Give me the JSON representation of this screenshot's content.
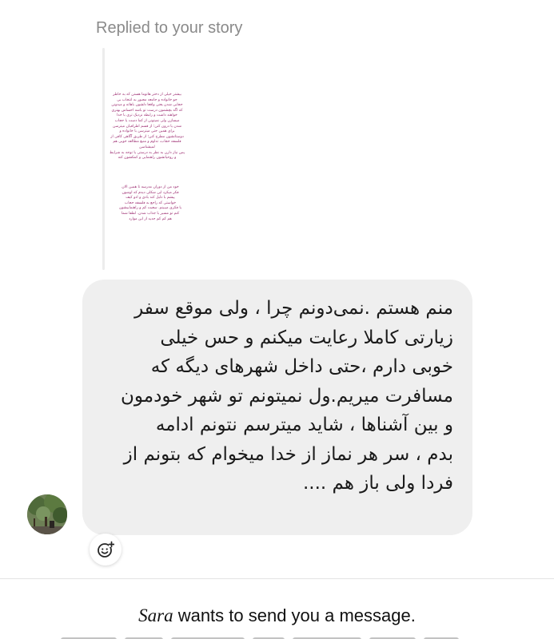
{
  "thread": {
    "reply_label": "Replied to your story"
  },
  "story": {
    "paragraph_1": "بیشتر خیلی از دختر هاتوما هستن که به خاطر\nجو خانواده و جامعه مجبور به انتخاب بی\nحجابی شدن یعنی واقعا دلشون باهاته و میدونن\nکه اگه بچشمون درست تو باشه احساس بهتری\nخواهند داشت و رابطه نزدیک تری با خدا\nمیسازن ولی نمیتونن از کما دست یا حجاب\nشدن یا درون کنن؛ از قسم اطرافیان میترسن\nبرای همین حتی میترسن با خانواده و\nدوستانشون مطرح کنن؛ از طریق آگاهی کافی از\nفلسفه حجاب، تداوم و منبع مطالعه خوبی هم\nلمیشناسن\nپس نیاز دارن به نظر به درستی یا توجه به شرایط\nو روحیاتشون راهنمایی و کمکشون کنه",
    "paragraph_2": "خود من از دوران مدرسه تا همین الان\nفکر میکرد این شکلی دیدم که اوشون\nپیشم با دلیل کند بادی و ادو کیف\nخواستی که راجع به فلسفه حجاب\nیا فکری میبینم. سعیت کم و راهنماییشون\nکنم تو مسیر با جذاب شدن. لطفا شما\nهم کم کم جدید از این موارد"
  },
  "message": {
    "text": "منم هستم .نمی‌دونم چرا ، ولی موقع سفر\nزیارتی کاملا رعایت میکنم و حس خیلی\nخوبی دارم ،حتی داخل شهرهای دیگه که\nمسافرت میریم.ول نمیتونم تو شهر خودمون\nو بین آشناها ، شاید میترسم نتونم ادامه\nبدم ، سر هر نماز از خدا میخوام که بتونم از\nفردا ولی باز هم ...."
  },
  "request": {
    "sender_name": "Sara",
    "suffix": " wants to send you a message."
  },
  "icons": {
    "avatar": "user-avatar-photo",
    "react": "add-reaction-icon"
  },
  "colors": {
    "bubble_bg": "#efefef",
    "story_text": "#9c2b70",
    "muted": "#8a8a8a"
  }
}
